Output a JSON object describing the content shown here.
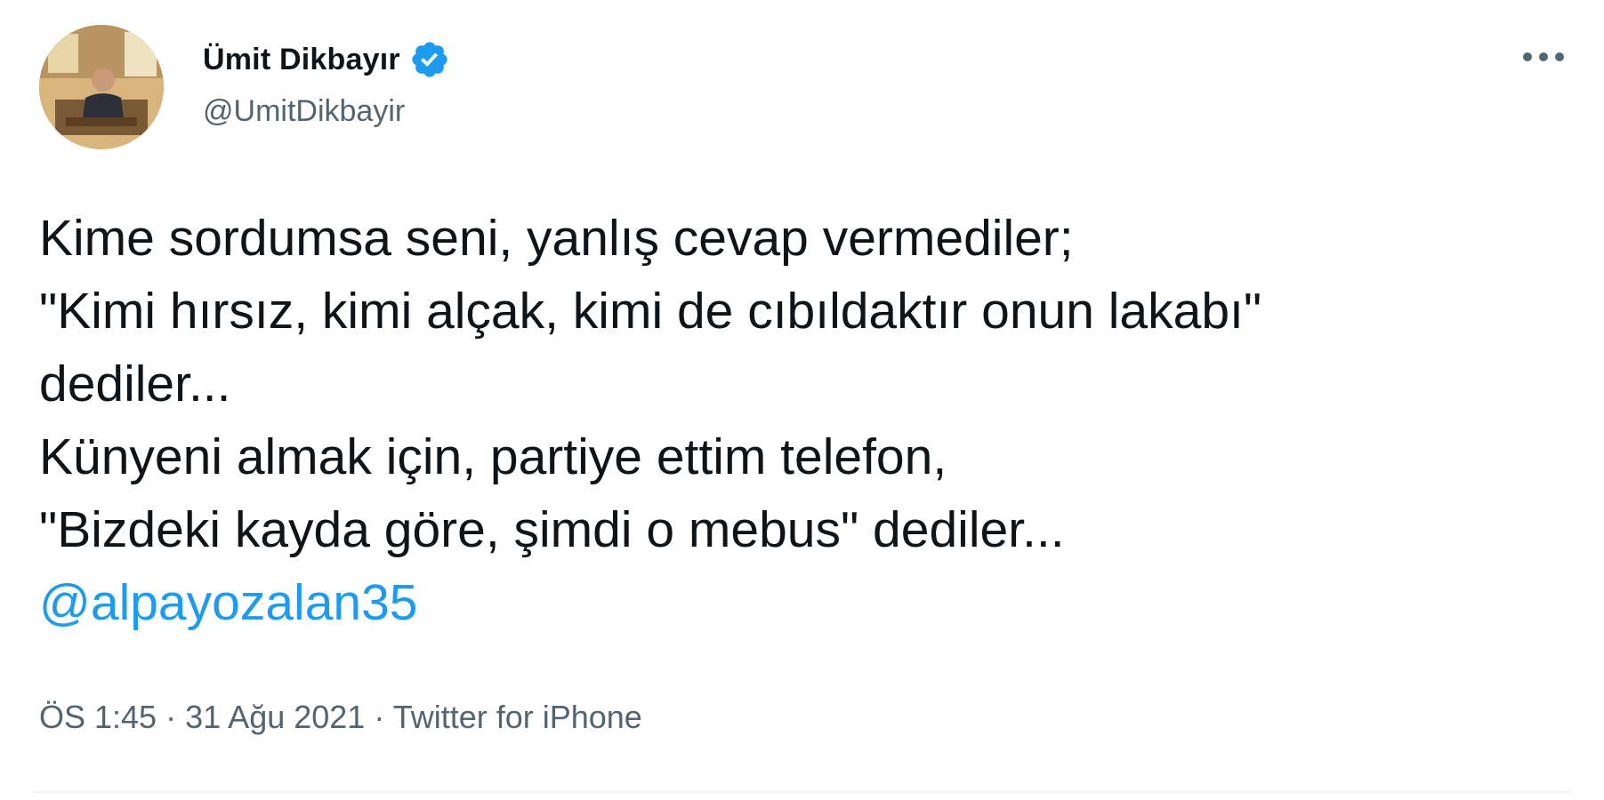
{
  "author": {
    "display_name": "Ümit Dikbayır",
    "handle": "@UmitDikbayir",
    "verified": true
  },
  "icons": {
    "avatar": "profile-photo",
    "verified": "verified-badge-icon",
    "more": "more-options-icon"
  },
  "colors": {
    "accent": "#1d9bf0",
    "text_primary": "#0f1419",
    "text_secondary": "#536471"
  },
  "tweet": {
    "lines": [
      "Kime sordumsa seni, yanlış cevap vermediler;",
      "\"Kimi hırsız, kimi alçak, kimi de cıbıldaktır onun lakabı\"",
      "dediler...",
      "Künyeni almak için, partiye ettim telefon,",
      "\"Bizdeki kayda göre, şimdi o mebus\" dediler..."
    ],
    "mention": "@alpayozalan35"
  },
  "meta": {
    "time": "ÖS 1:45",
    "separator": "·",
    "date": "31 Ağu 2021",
    "source": "Twitter for iPhone"
  }
}
